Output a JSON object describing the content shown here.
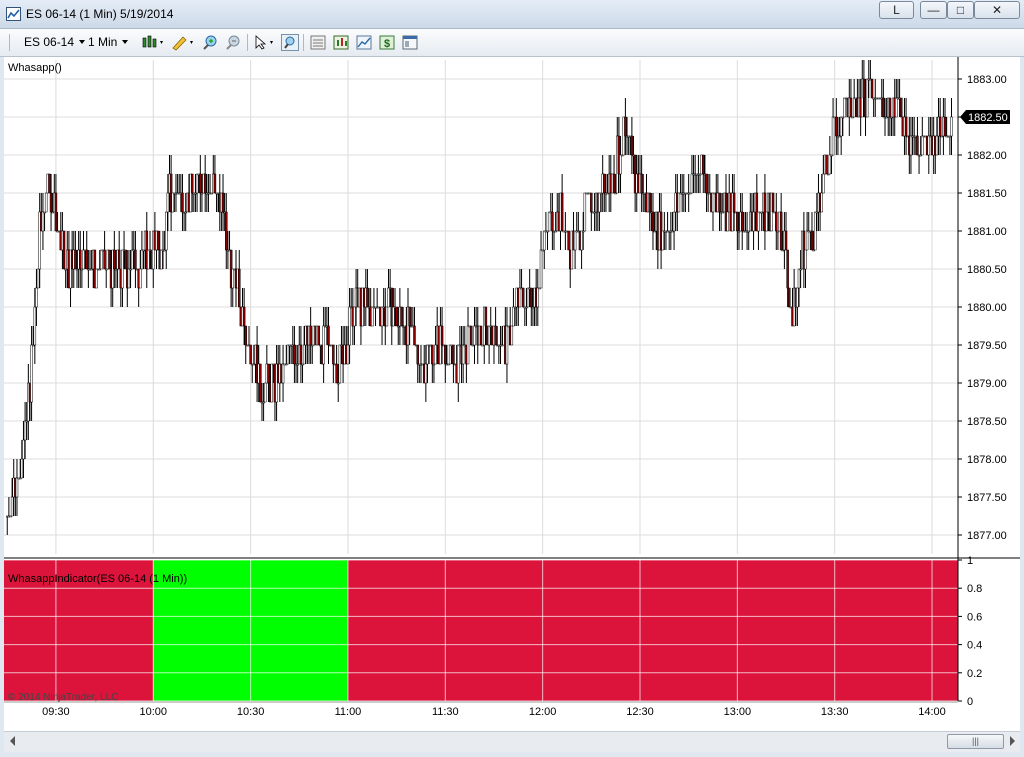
{
  "window": {
    "title": "ES 06-14 (1 Min)  5/19/2014",
    "btn_l": "L",
    "btn_min": "—",
    "btn_max": "□",
    "btn_close": "✕"
  },
  "toolbar": {
    "instrument": "ES 06-14",
    "interval": "1 Min",
    "icons": [
      "bar-type-icon",
      "pencil-draw-icon",
      "zoom-in-icon",
      "zoom-out-icon",
      "pointer-icon",
      "magnifier-icon",
      "data-box-icon",
      "chart-properties-icon",
      "line-style-icon",
      "strategy-dollar-icon",
      "templates-icon"
    ]
  },
  "colors": {
    "up_bar": "#000000",
    "down_bar": "#8b0000",
    "ind_red": "#dc143c",
    "ind_green": "#00ff00",
    "grid": "#dcdcdc"
  },
  "chart_data": [
    {
      "type": "candlestick",
      "panel_label": "Whasapp()",
      "y_ticks": [
        "1877.00",
        "1877.50",
        "1878.00",
        "1878.50",
        "1879.00",
        "1879.50",
        "1880.00",
        "1880.50",
        "1881.00",
        "1881.50",
        "1882.00",
        "1882.50",
        "1883.00"
      ],
      "ylim": [
        1876.75,
        1883.25
      ],
      "last_price": "1882.50",
      "x_ticks": [
        "09:30",
        "10:00",
        "10:30",
        "11:00",
        "11:30",
        "12:00",
        "12:30",
        "13:00",
        "13:30",
        "14:00"
      ],
      "xlim": [
        "09:14",
        "14:08"
      ],
      "close_path": [
        [
          "09:15",
          1877.25
        ],
        [
          "09:18",
          1877.75
        ],
        [
          "09:21",
          1878.5
        ],
        [
          "09:23",
          1879.5
        ],
        [
          "09:25",
          1881.0
        ],
        [
          "09:27",
          1881.5
        ],
        [
          "09:30",
          1881.25
        ],
        [
          "09:33",
          1880.5
        ],
        [
          "09:37",
          1880.75
        ],
        [
          "09:43",
          1880.5
        ],
        [
          "09:48",
          1880.5
        ],
        [
          "09:53",
          1880.5
        ],
        [
          "09:59",
          1880.75
        ],
        [
          "10:03",
          1880.75
        ],
        [
          "10:05",
          1881.5
        ],
        [
          "10:09",
          1881.5
        ],
        [
          "10:13",
          1881.5
        ],
        [
          "10:16",
          1881.75
        ],
        [
          "10:20",
          1881.5
        ],
        [
          "10:23",
          1880.75
        ],
        [
          "10:27",
          1880.0
        ],
        [
          "10:30",
          1879.5
        ],
        [
          "10:33",
          1879.0
        ],
        [
          "10:38",
          1879.0
        ],
        [
          "10:43",
          1879.5
        ],
        [
          "10:48",
          1879.5
        ],
        [
          "10:53",
          1879.5
        ],
        [
          "10:58",
          1879.25
        ],
        [
          "11:02",
          1880.0
        ],
        [
          "11:08",
          1880.0
        ],
        [
          "11:13",
          1880.0
        ],
        [
          "11:18",
          1879.75
        ],
        [
          "11:23",
          1879.25
        ],
        [
          "11:28",
          1879.5
        ],
        [
          "11:33",
          1879.25
        ],
        [
          "11:38",
          1879.5
        ],
        [
          "11:43",
          1879.75
        ],
        [
          "11:48",
          1879.5
        ],
        [
          "11:52",
          1880.0
        ],
        [
          "11:58",
          1880.25
        ],
        [
          "12:01",
          1881.0
        ],
        [
          "12:05",
          1881.25
        ],
        [
          "12:09",
          1880.75
        ],
        [
          "12:13",
          1881.25
        ],
        [
          "12:18",
          1881.5
        ],
        [
          "12:22",
          1881.75
        ],
        [
          "12:25",
          1882.25
        ],
        [
          "12:28",
          1881.75
        ],
        [
          "12:33",
          1881.25
        ],
        [
          "12:37",
          1881.0
        ],
        [
          "12:43",
          1881.5
        ],
        [
          "12:48",
          1881.75
        ],
        [
          "12:53",
          1881.5
        ],
        [
          "12:58",
          1881.25
        ],
        [
          "13:01",
          1881.0
        ],
        [
          "13:05",
          1881.25
        ],
        [
          "13:10",
          1881.25
        ],
        [
          "13:14",
          1881.0
        ],
        [
          "13:17",
          1879.75
        ],
        [
          "13:20",
          1880.75
        ],
        [
          "13:25",
          1881.25
        ],
        [
          "13:28",
          1882.0
        ],
        [
          "13:31",
          1882.5
        ],
        [
          "13:37",
          1882.75
        ],
        [
          "13:43",
          1882.75
        ],
        [
          "13:48",
          1882.75
        ],
        [
          "13:53",
          1882.25
        ],
        [
          "13:58",
          1882.0
        ],
        [
          "14:01",
          1882.25
        ],
        [
          "14:06",
          1882.5
        ]
      ]
    },
    {
      "type": "area",
      "panel_label": "WhasappIndicator(ES 06-14 (1 Min))",
      "y_ticks": [
        "0",
        "0.2",
        "0.4",
        "0.6",
        "0.8",
        "1"
      ],
      "ylim": [
        0,
        1
      ],
      "segments": [
        {
          "start": "09:14",
          "end": "10:00",
          "signal": "red"
        },
        {
          "start": "10:00",
          "end": "11:00",
          "signal": "green"
        },
        {
          "start": "11:00",
          "end": "14:08",
          "signal": "red"
        }
      ],
      "copyright": "© 2014 NinjaTrader, LLC"
    }
  ]
}
